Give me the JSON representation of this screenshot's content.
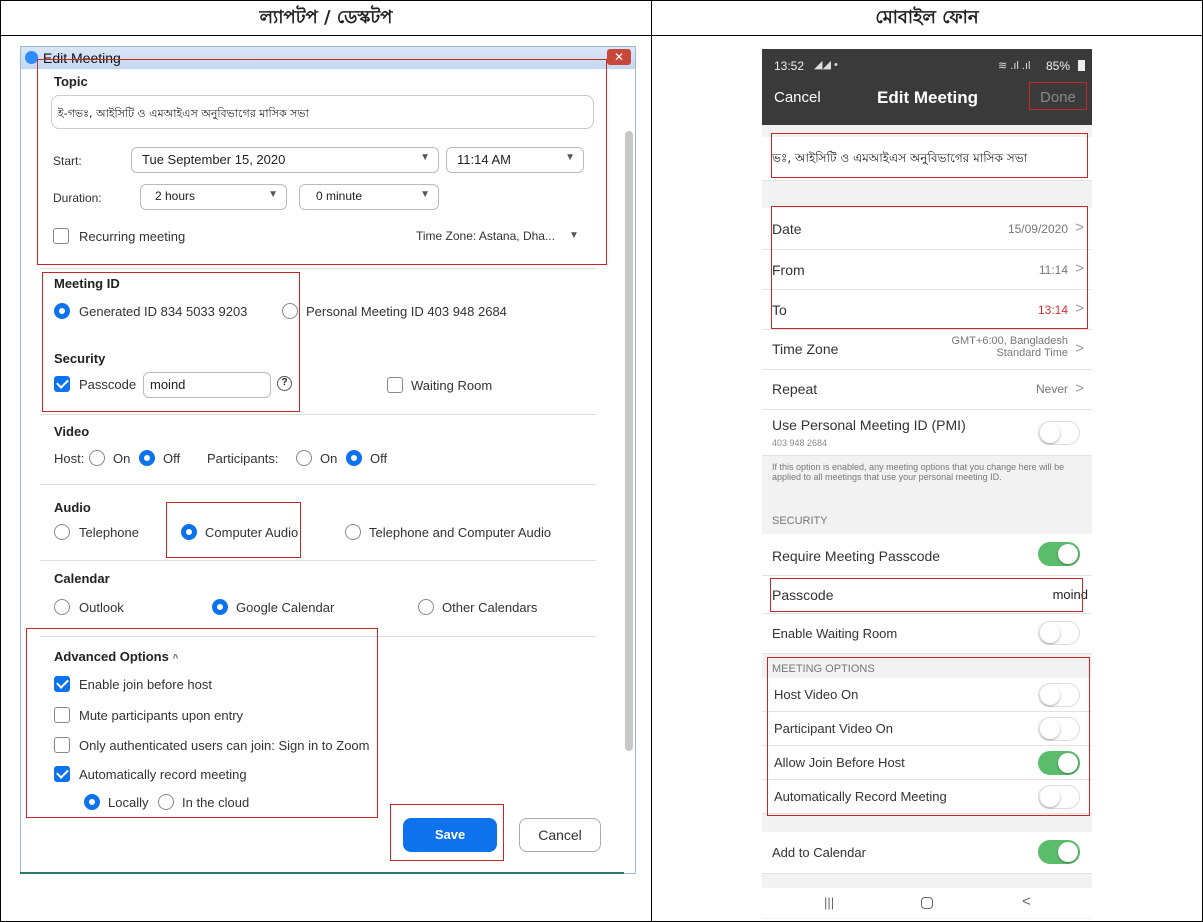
{
  "headers": {
    "left": "ল্যাপটপ / ডেস্কটপ",
    "right": "মোবাইল ফোন"
  },
  "desktop": {
    "window_title": "Edit Meeting",
    "topic_label": "Topic",
    "topic_value": "ই-গভঃ, আইসিটি ও এমআইএস অনুবিভাগের মাসিক সভা",
    "start_label": "Start:",
    "start_date": "Tue  September  15,  2020",
    "start_time": "11:14  AM",
    "duration_label": "Duration:",
    "duration_hours": "2 hours",
    "duration_minutes": "0 minute",
    "recurring_label": "Recurring meeting",
    "timezone": "Time Zone: Astana, Dha...",
    "meeting_id_label": "Meeting ID",
    "generated_id": "Generated ID 834 5033 9203",
    "personal_id": "Personal Meeting ID 403 948 2684",
    "security_label": "Security",
    "passcode_label": "Passcode",
    "passcode_value": "moind",
    "waiting_room_label": "Waiting Room",
    "video_label": "Video",
    "host_label": "Host:",
    "on_label": "On",
    "off_label": "Off",
    "participants_label": "Participants:",
    "audio_label": "Audio",
    "telephone_label": "Telephone",
    "computer_audio_label": "Computer Audio",
    "tel_computer_label": "Telephone and Computer Audio",
    "calendar_label": "Calendar",
    "outlook_label": "Outlook",
    "google_label": "Google Calendar",
    "other_cal_label": "Other Calendars",
    "advanced_label": "Advanced Options",
    "adv_join": "Enable join before host",
    "adv_mute": "Mute participants upon entry",
    "adv_auth": "Only authenticated users can join: Sign in to Zoom",
    "adv_record": "Automatically record meeting",
    "locally_label": "Locally",
    "cloud_label": "In the cloud",
    "save_label": "Save",
    "cancel_label": "Cancel"
  },
  "mobile": {
    "status_time": "13:52",
    "status_battery": "85%",
    "cancel_label": "Cancel",
    "title": "Edit Meeting",
    "done_label": "Done",
    "topic_value": "ভঃ, আইসিটি ও এমআইএস অনুবিভাগের মাসিক সভা",
    "date_label": "Date",
    "date_value": "15/09/2020",
    "from_label": "From",
    "from_value": "11:14",
    "to_label": "To",
    "to_value": "13:14",
    "timezone_label": "Time Zone",
    "timezone_value": "GMT+6:00, Bangladesh Standard Time",
    "repeat_label": "Repeat",
    "repeat_value": "Never",
    "pmi_label": "Use Personal Meeting ID (PMI)",
    "pmi_value": "403 948 2684",
    "pmi_note": "If this option is enabled, any meeting options that you change here will be applied to all meetings that use your personal meeting ID.",
    "security_header": "SECURITY",
    "req_passcode_label": "Require Meeting Passcode",
    "passcode_label": "Passcode",
    "passcode_value": "moind",
    "waiting_room_label": "Enable Waiting Room",
    "options_header": "MEETING OPTIONS",
    "host_video_label": "Host Video On",
    "participant_video_label": "Participant Video On",
    "allow_join_label": "Allow Join Before Host",
    "auto_record_label": "Automatically Record Meeting",
    "add_calendar_label": "Add to Calendar"
  },
  "colors": {
    "accent": "#0e72ed",
    "highlight": "#c62828",
    "toggle_on": "#5bbd6b",
    "mobile_header": "#3a3a3a"
  }
}
